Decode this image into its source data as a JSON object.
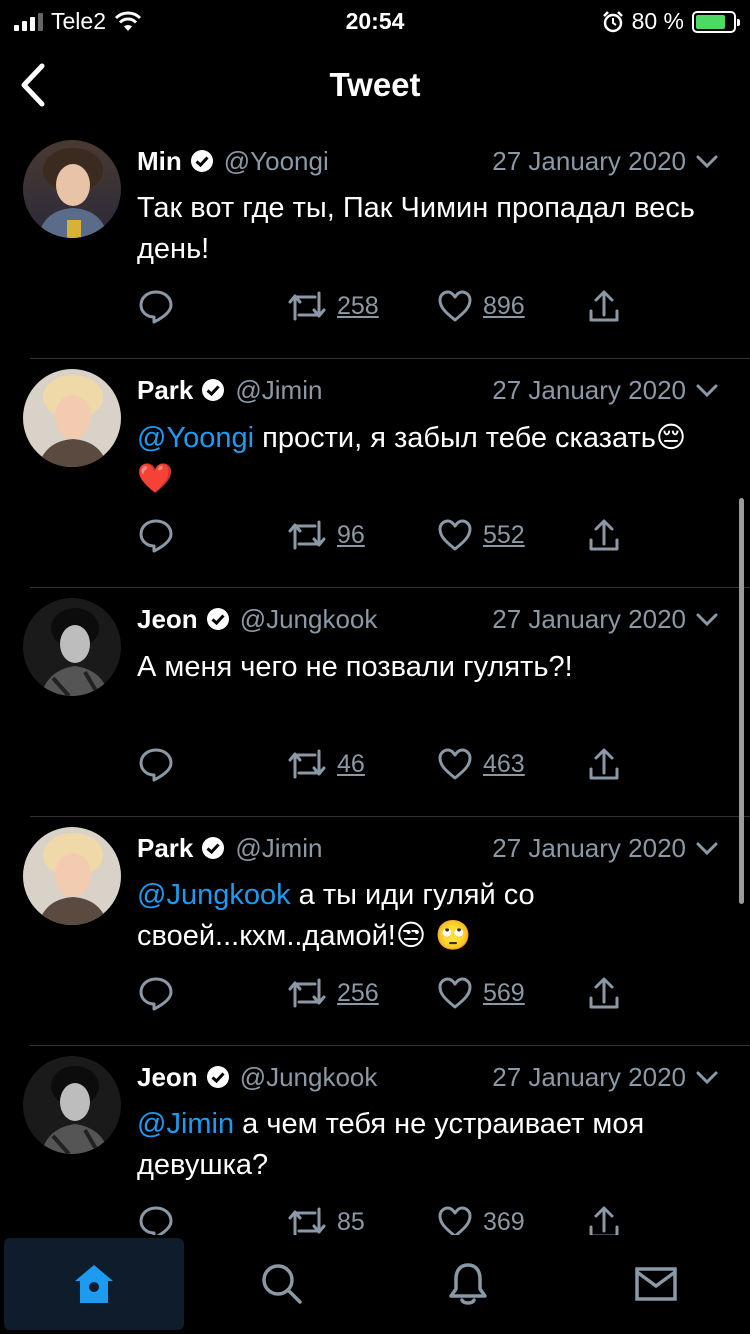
{
  "status_bar": {
    "carrier": "Tele2",
    "time": "20:54",
    "battery_text": "80 %"
  },
  "header": {
    "title": "Tweet"
  },
  "tweets": [
    {
      "avatar_label": "Yoongi avatar",
      "name": "Min",
      "handle": "@Yoongi",
      "date": "27 January 2020",
      "mention": "",
      "text": "Так вот где ты, Пак Чимин пропадал весь день!",
      "emoji": "",
      "retweets": "258",
      "likes": "896"
    },
    {
      "avatar_label": "Jimin avatar",
      "name": "Park",
      "handle": "@Jimin",
      "date": "27 January 2020",
      "mention": "@Yoongi",
      "text": " прости, я забыл тебе сказать",
      "emoji": "😔 ❤️",
      "retweets": "96",
      "likes": "552"
    },
    {
      "avatar_label": "Jungkook avatar",
      "name": "Jeon",
      "handle": "@Jungkook",
      "date": "27 January 2020",
      "mention": "",
      "text": "А меня чего не позвали гулять?!",
      "emoji": "",
      "retweets": "46",
      "likes": "463"
    },
    {
      "avatar_label": "Jimin avatar",
      "name": "Park",
      "handle": "@Jimin",
      "date": "27 January 2020",
      "mention": "@Jungkook",
      "text": " а ты иди гуляй со своей...кхм..дамой!",
      "emoji": "😒 🙄",
      "retweets": "256",
      "likes": "569"
    },
    {
      "avatar_label": "Jungkook avatar",
      "name": "Jeon",
      "handle": "@Jungkook",
      "date": "27 January 2020",
      "mention": "@Jimin",
      "text": " а чем тебя не устраивает моя девушка?",
      "emoji": "",
      "retweets": "85",
      "likes": "369"
    }
  ],
  "tabbar": {
    "items": [
      {
        "icon": "home-icon",
        "active": true
      },
      {
        "icon": "search-icon",
        "active": false
      },
      {
        "icon": "bell-icon",
        "active": false
      },
      {
        "icon": "mail-icon",
        "active": false
      }
    ]
  },
  "colors": {
    "accent": "#1d9bf0",
    "muted": "#8b98a5",
    "battery": "#4cd964",
    "divider": "#2f3336"
  }
}
